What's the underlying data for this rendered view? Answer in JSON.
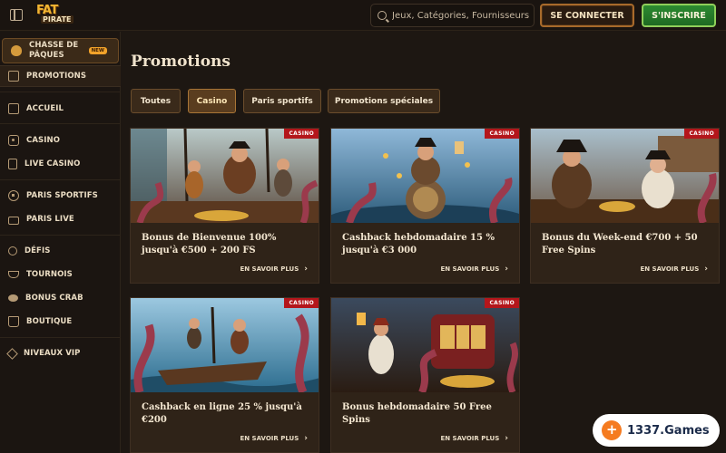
{
  "header": {
    "logo_top": "FAT",
    "logo_bottom": "PIRATE",
    "search_placeholder": "Jeux, Catégories, Fournisseurs",
    "login_label": "SE CONNECTER",
    "signup_label": "S'INSCRIRE"
  },
  "sidebar": {
    "items": [
      {
        "label": "CHASSE DE PÂQUES",
        "icon": "egg-icon",
        "badge": "NEW"
      },
      {
        "label": "PROMOTIONS",
        "icon": "gift-box-icon"
      },
      {
        "label": "ACCUEIL",
        "icon": "home-icon"
      },
      {
        "label": "CASINO",
        "icon": "casino-chip-icon"
      },
      {
        "label": "LIVE CASINO",
        "icon": "card-icon"
      },
      {
        "label": "PARIS SPORTIFS",
        "icon": "soccer-ball-icon"
      },
      {
        "label": "PARIS LIVE",
        "icon": "live-tv-icon"
      },
      {
        "label": "DÉFIS",
        "icon": "bulb-icon"
      },
      {
        "label": "TOURNOIS",
        "icon": "trophy-icon"
      },
      {
        "label": "BONUS CRAB",
        "icon": "crab-icon"
      },
      {
        "label": "BOUTIQUE",
        "icon": "shopping-bag-icon"
      },
      {
        "label": "NIVEAUX VIP",
        "icon": "diamond-icon"
      }
    ]
  },
  "main": {
    "title": "Promotions",
    "tabs": [
      {
        "label": "Toutes"
      },
      {
        "label": "Casino",
        "selected": true
      },
      {
        "label": "Paris sportifs"
      },
      {
        "label": "Promotions spéciales"
      }
    ],
    "cards": [
      {
        "tag": "CASINO",
        "title": "Bonus de Bienvenue 100% jusqu'à €500 + 200 FS",
        "cta": "EN SAVOIR PLUS"
      },
      {
        "tag": "CASINO",
        "title": "Cashback hebdomadaire 15 % jusqu'à €3 000",
        "cta": "EN SAVOIR PLUS"
      },
      {
        "tag": "CASINO",
        "title": "Bonus du Week-end €700 + 50 Free Spins",
        "cta": "EN SAVOIR PLUS"
      },
      {
        "tag": "CASINO",
        "title": "Cashback en ligne 25 % jusqu'à €200",
        "cta": "EN SAVOIR PLUS"
      },
      {
        "tag": "CASINO",
        "title": "Bonus hebdomadaire 50 Free Spins",
        "cta": "EN SAVOIR PLUS"
      }
    ]
  },
  "watermark": {
    "text": "1337.Games"
  },
  "colors": {
    "background": "#1d1712",
    "accent_gold": "#f2b632",
    "signup_green": "#2d8a31",
    "casino_tag_red": "#b4161b"
  }
}
